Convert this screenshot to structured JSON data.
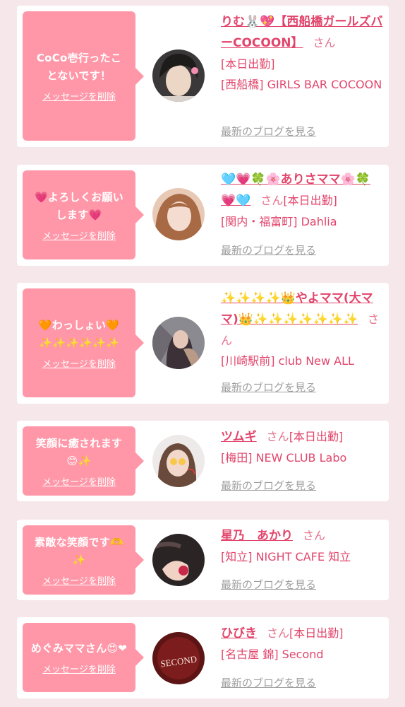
{
  "cards": [
    {
      "message": "CoCo壱行ったこ\nとないです！",
      "delete_label": "メッセージを削除",
      "name": "りむ🐰💖【西船橋ガールズバーCOCOON】",
      "honorific": "さん",
      "status": "[本日出勤]",
      "shop": "[西船橋] GIRLS BAR COCOON",
      "blog_link": "最新のブログを見る"
    },
    {
      "message": "💗よろしくお願い\nします💗",
      "delete_label": "メッセージを削除",
      "name": "🩵💗🍀🌸ありさママ🌸🍀💗🩵",
      "honorific": "さん",
      "status": "[本日出勤]",
      "shop": "[関内・福富町] Dahlia",
      "blog_link": "最新のブログを見る"
    },
    {
      "message": "🧡わっしょい🧡\n✨✨✨✨✨✨",
      "delete_label": "メッセージを削除",
      "name": "✨✨✨✨👑やよママ(大ママ)👑✨✨✨✨✨✨✨",
      "honorific": "さん",
      "status": "",
      "shop": "[川崎駅前] club New ALL",
      "blog_link": "最新のブログを見る"
    },
    {
      "message": "笑顔に癒されます\n😊✨",
      "delete_label": "メッセージを削除",
      "name": "ツムギ",
      "honorific": "さん",
      "status": "[本日出勤]",
      "shop": "[梅田] NEW CLUB Labo",
      "blog_link": "最新のブログを見る"
    },
    {
      "message": "素敵な笑顔です🫶\n✨",
      "delete_label": "メッセージを削除",
      "name": "星乃　あかり",
      "honorific": "さん",
      "status": "",
      "shop": "[知立] NIGHT CAFE 知立",
      "blog_link": "最新のブログを見る"
    },
    {
      "message": "めぐみママさん😍❤",
      "delete_label": "メッセージを削除",
      "name": "ひびき",
      "honorific": "さん",
      "status": "[本日出勤]",
      "shop": "[名古屋 錦] Second",
      "blog_link": "最新のブログを見る"
    }
  ],
  "avatar_texts": {
    "card6": "SECOND"
  },
  "colors": {
    "background": "#f6e7ea",
    "bubble": "#ff97a8",
    "name_text": "#e2456b",
    "blog_link": "#9e9e9e"
  }
}
